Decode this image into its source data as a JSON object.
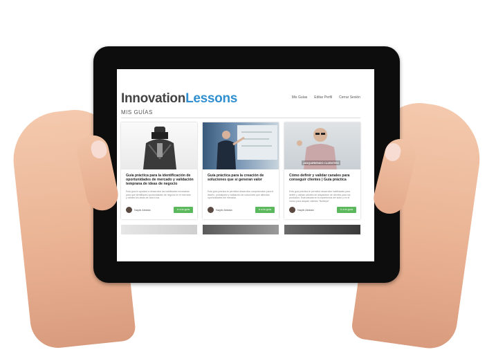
{
  "screen": {
    "logo_part1": "Innovation",
    "logo_part2": "Lessons",
    "nav": [
      "Mis Guías",
      "Editar Perfil",
      "Cerrar Sesión"
    ],
    "section_title": "MIS GUÍAS",
    "cards": [
      {
        "title": "Guía práctica para la identificación de oportunidades de mercado y validación temprana de ideas de negocio",
        "description": "Esta guía te ayudará a desarrollar las habilidades necesarias para que identifiques oportunidades de negocio en el mercado y valides tus ideas de cara a tus",
        "author": "Nayib Abdala",
        "button": "Ir a la guía"
      },
      {
        "title": "Guía práctica para la creación de soluciones que sí generan valor",
        "description": "Esta guía práctica te permitirá desarrollar competencias para el diseño, prototipado y validación de soluciones que atiendan oportunidades del mercado.",
        "author": "Nayib Abdala",
        "button": "Ir a la guía"
      },
      {
        "title": "Cómo definir y validar canales para conseguir clientes | Guía práctica",
        "description": "Esta guía práctica te permitirá desarrollar habilidades para definir y validar canales de adquisición de clientes para tus productos. Está basada en la experiencia del autor y en el marco para adquirir clientes \"Bullseye\"",
        "author": "Nayib Abdala",
        "button": "Ir a la guía",
        "image_caption": "¡ADQUIRIENDO CLIENTES!"
      }
    ]
  },
  "colors": {
    "accent": "#2f8fd0",
    "button": "#5cb85c",
    "tablet_frame": "#0d0d0d"
  }
}
